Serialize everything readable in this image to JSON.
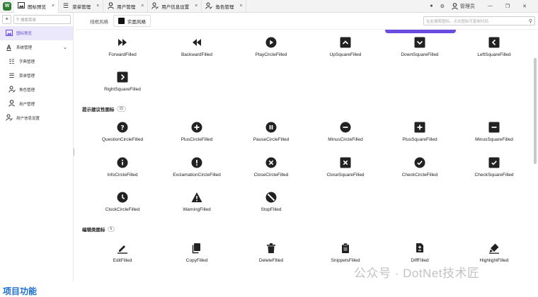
{
  "tabbar": {
    "app_logo": "W",
    "tabs": [
      {
        "label": "图标预览",
        "icon": "image-icon",
        "active": true
      },
      {
        "label": "菜单管理",
        "icon": "menu-icon",
        "active": false
      },
      {
        "label": "用户管理",
        "icon": "user-icon",
        "active": false
      },
      {
        "label": "用户信息设置",
        "icon": "user-settings-icon",
        "active": false
      },
      {
        "label": "角色管理",
        "icon": "role-icon",
        "active": false
      }
    ],
    "close_glyph": "×",
    "user_label": "管理员"
  },
  "sidebar": {
    "search_placeholder": "搜索菜单",
    "items": [
      {
        "label": "图标预览",
        "active": true,
        "sub": false
      },
      {
        "label": "系统管理",
        "active": false,
        "sub": false,
        "expanded": true
      },
      {
        "label": "字典管理",
        "active": false,
        "sub": true
      },
      {
        "label": "菜单管理",
        "active": false,
        "sub": true
      },
      {
        "label": "角色管理",
        "active": false,
        "sub": true
      },
      {
        "label": "用户管理",
        "active": false,
        "sub": true
      },
      {
        "label": "用户信息设置",
        "active": false,
        "sub": false
      }
    ]
  },
  "toolbar": {
    "style_tabs": [
      {
        "label": "线框风格",
        "active": false
      },
      {
        "label": "实面风格",
        "active": true
      }
    ],
    "search_placeholder": "在此搜索图标，点击图标可复制代码"
  },
  "sections": {
    "directional_row1": [
      "ForwardFilled",
      "BackwardFilled",
      "PlayCircleFilled",
      "UpSquareFilled",
      "DownSquareFilled",
      "LeftSquareFilled"
    ],
    "directional_row2": [
      "RightSquareFilled"
    ],
    "suggestion": {
      "title": "提示建议性图标",
      "count": "15",
      "rows": [
        [
          "QuestionCircleFilled",
          "PlusCircleFilled",
          "PauseCircleFilled",
          "MinusCircleFilled",
          "PlusSquareFilled",
          "MinusSquareFilled"
        ],
        [
          "InfoCircleFilled",
          "ExclamationCircleFilled",
          "CloseCircleFilled",
          "CloseSquareFilled",
          "CheckCircleFilled",
          "CheckSquareFilled"
        ],
        [
          "ClockCircleFilled",
          "WarningFilled",
          "StopFilled"
        ]
      ]
    },
    "edit": {
      "title": "编辑类图标",
      "count": "6",
      "rows": [
        [
          "EditFilled",
          "CopyFilled",
          "DeleteFilled",
          "SnippetsFilled",
          "DiffFilled",
          "HighlightFilled"
        ]
      ]
    }
  },
  "watermark": "公众号 · DotNet技术匠",
  "bottom_heading": "项目功能",
  "colors": {
    "accent": "#6a4de0",
    "heading": "#1a6fd0"
  }
}
